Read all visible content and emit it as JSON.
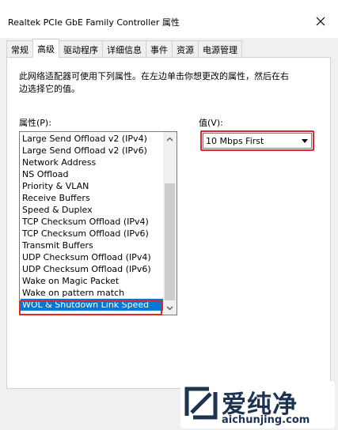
{
  "window": {
    "title": "Realtek PCIe GbE Family Controller 属性",
    "close_glyph": "✕"
  },
  "tabs": [
    {
      "label": "常规",
      "active": false
    },
    {
      "label": "高级",
      "active": true
    },
    {
      "label": "驱动程序",
      "active": false
    },
    {
      "label": "详细信息",
      "active": false
    },
    {
      "label": "事件",
      "active": false
    },
    {
      "label": "资源",
      "active": false
    },
    {
      "label": "电源管理",
      "active": false
    }
  ],
  "advanced": {
    "description": "此网络适配器可使用下列属性。在左边单击你想更改的属性，然后在右边选择它的值。",
    "properties_label": "属性(P):",
    "value_label": "值(V):",
    "properties": [
      "Large Send Offload v2 (IPv4)",
      "Large Send Offload v2 (IPv6)",
      "Network Address",
      "NS Offload",
      "Priority & VLAN",
      "Receive Buffers",
      "Speed & Duplex",
      "TCP Checksum Offload (IPv4)",
      "TCP Checksum Offload (IPv6)",
      "Transmit Buffers",
      "UDP Checksum Offload (IPv4)",
      "UDP Checksum Offload (IPv6)",
      "Wake on Magic Packet",
      "Wake on pattern match",
      "WOL & Shutdown Link Speed"
    ],
    "selected_property": "WOL & Shutdown Link Speed",
    "selected_value": "10 Mbps First"
  },
  "watermark": {
    "text": "爱纯净",
    "url": "aichunjing.com"
  },
  "colors": {
    "selection": "#0078d7",
    "highlight": "#e0262b",
    "watermark": "#1e3350"
  }
}
